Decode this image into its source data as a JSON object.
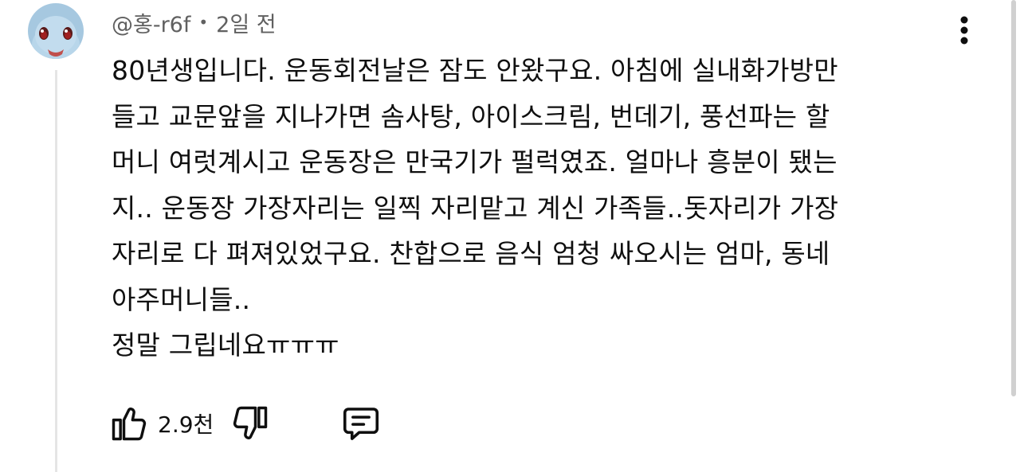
{
  "comment": {
    "author": "@홍-r6f",
    "separator": "•",
    "time": "2일 전",
    "lines": [
      "80년생입니다. 운동회전날은 잠도 안왔구요. 아침에 실내화가방만",
      "들고 교문앞을 지나가면 솜사탕, 아이스크림, 번데기, 풍선파는 할",
      "머니 여럿계시고 운동장은 만국기가 펄럭였죠. 얼마나 흥분이 됐는",
      "지.. 운동장 가장자리는 일찍 자리맡고 계신 가족들..돗자리가 가장",
      "자리로 다 펴져있었구요. 찬합으로 음식 엄청 싸오시는 엄마, 동네",
      "아주머니들..",
      "정말 그립네요ㅠㅠㅠ"
    ],
    "like_count": "2.9천"
  },
  "icons": {
    "avatar": "squirtle-avatar",
    "more": "more-vert-icon",
    "like": "thumb-up-icon",
    "dislike": "thumb-down-icon",
    "reply": "reply-comment-icon"
  },
  "colors": {
    "text": "#0f0f0f",
    "meta_text": "#606060",
    "avatar_bg": "#a6c8e0",
    "thread_line": "#e5e5e5"
  }
}
